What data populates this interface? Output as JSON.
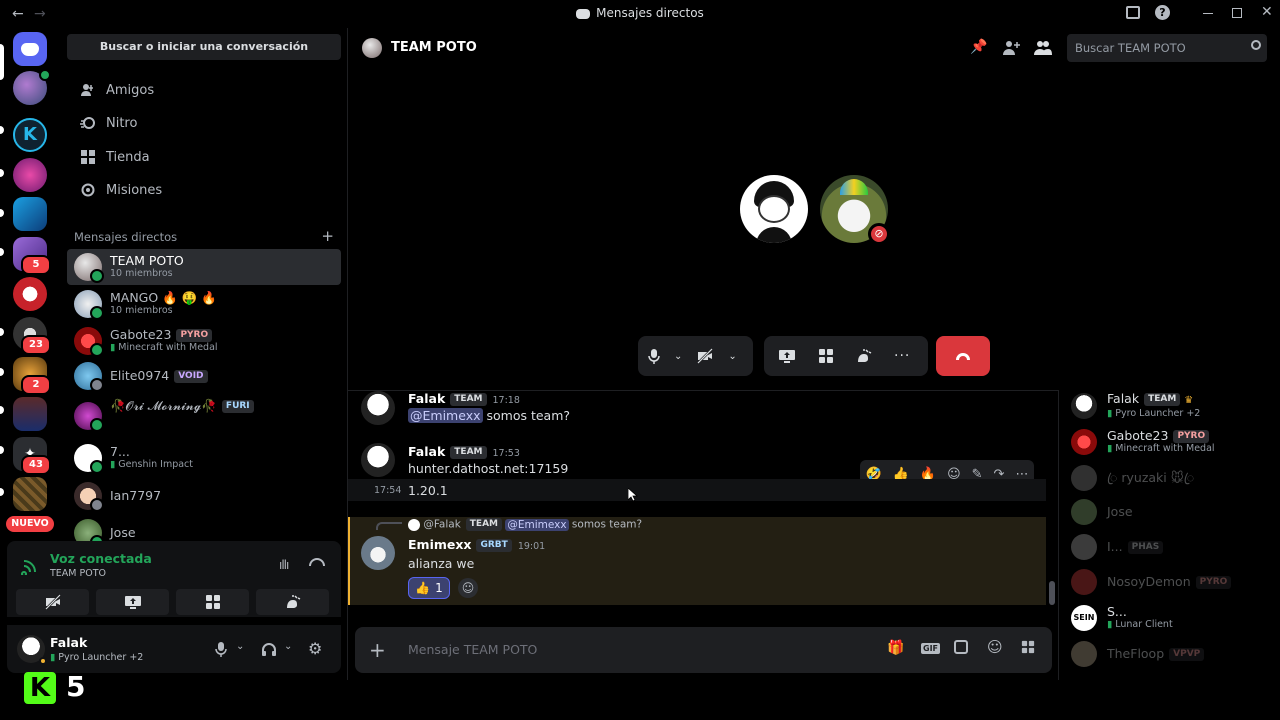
{
  "window": {
    "title": "Mensajes directos"
  },
  "dm_sidebar": {
    "search_placeholder": "Buscar o iniciar una conversación",
    "nav": [
      {
        "label": "Amigos",
        "icon": "friends-icon"
      },
      {
        "label": "Nitro",
        "icon": "nitro-icon"
      },
      {
        "label": "Tienda",
        "icon": "shop-icon"
      },
      {
        "label": "Misiones",
        "icon": "quests-icon"
      }
    ],
    "dm_header": "Mensajes directos",
    "dms": [
      {
        "name": "TEAM POTO",
        "sub": "10 miembros",
        "tag": ""
      },
      {
        "name": "MANGO 🔥 🤑 🔥",
        "sub": "10 miembros",
        "tag": ""
      },
      {
        "name": "Gabote23",
        "sub": "Minecraft with Medal",
        "tag": "PYRO"
      },
      {
        "name": "Elite0974",
        "sub": "",
        "tag": "VOID"
      },
      {
        "name": "🥀𝓞𝓻𝓲 𝓜𝓸𝓻𝓷𝓲𝓷𝓰🥀",
        "sub": "",
        "tag": "FURI"
      },
      {
        "name": "7...",
        "sub": "Genshin Impact",
        "tag": ""
      },
      {
        "name": "Ian7797",
        "sub": "",
        "tag": ""
      },
      {
        "name": "Jose",
        "sub": "",
        "tag": ""
      }
    ]
  },
  "rail": {
    "badges": [
      "5",
      "23",
      "2",
      "43"
    ],
    "new_label": "NUEVO"
  },
  "voice_panel": {
    "status": "Voz conectada",
    "channel": "TEAM POTO"
  },
  "user_panel": {
    "name": "Falak",
    "activity": "Pyro Launcher +2"
  },
  "header": {
    "title": "TEAM POTO",
    "search_placeholder": "Buscar TEAM POTO"
  },
  "messages": [
    {
      "author": "Falak",
      "tag": "TEAM",
      "time": "17:18",
      "mention": "@Emimexx",
      "text": "somos team?"
    },
    {
      "author": "Falak",
      "tag": "TEAM",
      "time": "17:53",
      "text": "hunter.dathost.net:17159"
    },
    {
      "time": "17:54",
      "text": "1.20.1"
    },
    {
      "reply_author": "@Falak",
      "reply_tag": "TEAM",
      "reply_mention": "@Emimexx",
      "reply_text": "somos team?",
      "author": "Emimexx",
      "tag": "GRBT",
      "time": "19:01",
      "text": "alianza we",
      "reaction": "👍",
      "reaction_count": "1"
    }
  ],
  "composer": {
    "placeholder": "Mensaje TEAM POTO",
    "gif": "GIF"
  },
  "members": [
    {
      "name": "Falak",
      "tag": "TEAM",
      "sub": "Pyro Launcher +2"
    },
    {
      "name": "Gabote23",
      "tag": "PYRO",
      "sub": "Minecraft with Medal"
    },
    {
      "name": "ꦿ ryuzaki 🐭ꦿ",
      "tag": "",
      "sub": ""
    },
    {
      "name": "Jose",
      "tag": "",
      "sub": ""
    },
    {
      "name": "I...",
      "tag": "PHAS",
      "sub": ""
    },
    {
      "name": "NosoyDemon",
      "tag": "PYRO",
      "sub": ""
    },
    {
      "name": "S...",
      "tag": "",
      "sub": "Lunar Client"
    },
    {
      "name": "TheFloop",
      "tag": "VPVP",
      "sub": ""
    }
  ],
  "overlay": {
    "label": "5"
  },
  "colors": {
    "accent": "#5865f2",
    "danger": "#da373c",
    "online": "#23a55a"
  }
}
